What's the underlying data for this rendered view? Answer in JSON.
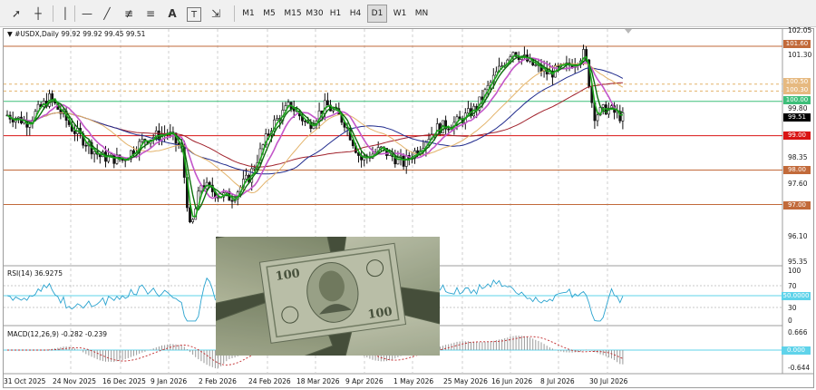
{
  "toolbar": {
    "tools": [
      {
        "name": "cursor-icon",
        "glyph": "➚"
      },
      {
        "name": "crosshair-icon",
        "glyph": "┼"
      },
      {
        "name": "vertical-line-icon",
        "glyph": "│"
      },
      {
        "name": "horizontal-line-icon",
        "glyph": "—"
      },
      {
        "name": "trendline-icon",
        "glyph": "╱"
      },
      {
        "name": "equidistant-channel-icon",
        "glyph": "≢"
      },
      {
        "name": "fibonacci-icon",
        "glyph": "≡"
      },
      {
        "name": "text-icon",
        "glyph": "A"
      },
      {
        "name": "text-label-icon",
        "glyph": "T"
      },
      {
        "name": "arrows-icon",
        "glyph": "⇲"
      }
    ],
    "timeframes": [
      "M1",
      "M5",
      "M15",
      "M30",
      "H1",
      "H4",
      "D1",
      "W1",
      "MN"
    ],
    "active_timeframe": "D1"
  },
  "chart": {
    "header": "▼ #USDX,Daily  99.92 99.92 99.45 99.51",
    "price_axis": [
      "102.05",
      "101.30",
      "99.80",
      "98.35",
      "97.60",
      "96.10",
      "95.35"
    ],
    "price_tags": [
      {
        "label": "101.60",
        "color": "#c26a3a"
      },
      {
        "label": "100.50",
        "color": "#e6b980"
      },
      {
        "label": "100.30",
        "color": "#e6b980"
      },
      {
        "label": "100.00",
        "color": "#3ebf7a"
      },
      {
        "label": "99.51",
        "color": "#000000"
      },
      {
        "label": "99.00",
        "color": "#d91414"
      },
      {
        "label": "98.00",
        "color": "#c26a3a"
      },
      {
        "label": "97.00",
        "color": "#c26a3a"
      }
    ],
    "dates": [
      "31 Oct 2025",
      "24 Nov 2025",
      "16 Dec 2025",
      "9 Jan 2026",
      "2 Feb 2026",
      "24 Feb 2026",
      "18 Mar 2026",
      "9 Apr 2026",
      "1 May 2026",
      "25 May 2026",
      "16 Jun 2026",
      "8 Jul 2026",
      "30 Jul 2026"
    ]
  },
  "rsi": {
    "label": "RSI(14) 36.9275",
    "axis": [
      "100",
      "70",
      "30",
      "0"
    ],
    "level_tag": "50.0000"
  },
  "macd": {
    "label": "MACD(12,26,9) -0.282 -0.239",
    "axis": [
      "0.666",
      "-0.644"
    ],
    "level_tag": "0.000"
  },
  "colors": {
    "green": "#1aa51a",
    "purple": "#c356c9",
    "navy": "#1f2a8c",
    "dark_red": "#a0202a",
    "tan": "#e3b36a",
    "cyan": "#2aa3cf",
    "brown_level": "#c26a3a",
    "red_level": "#d91414",
    "green_level": "#3ebf7a"
  }
}
